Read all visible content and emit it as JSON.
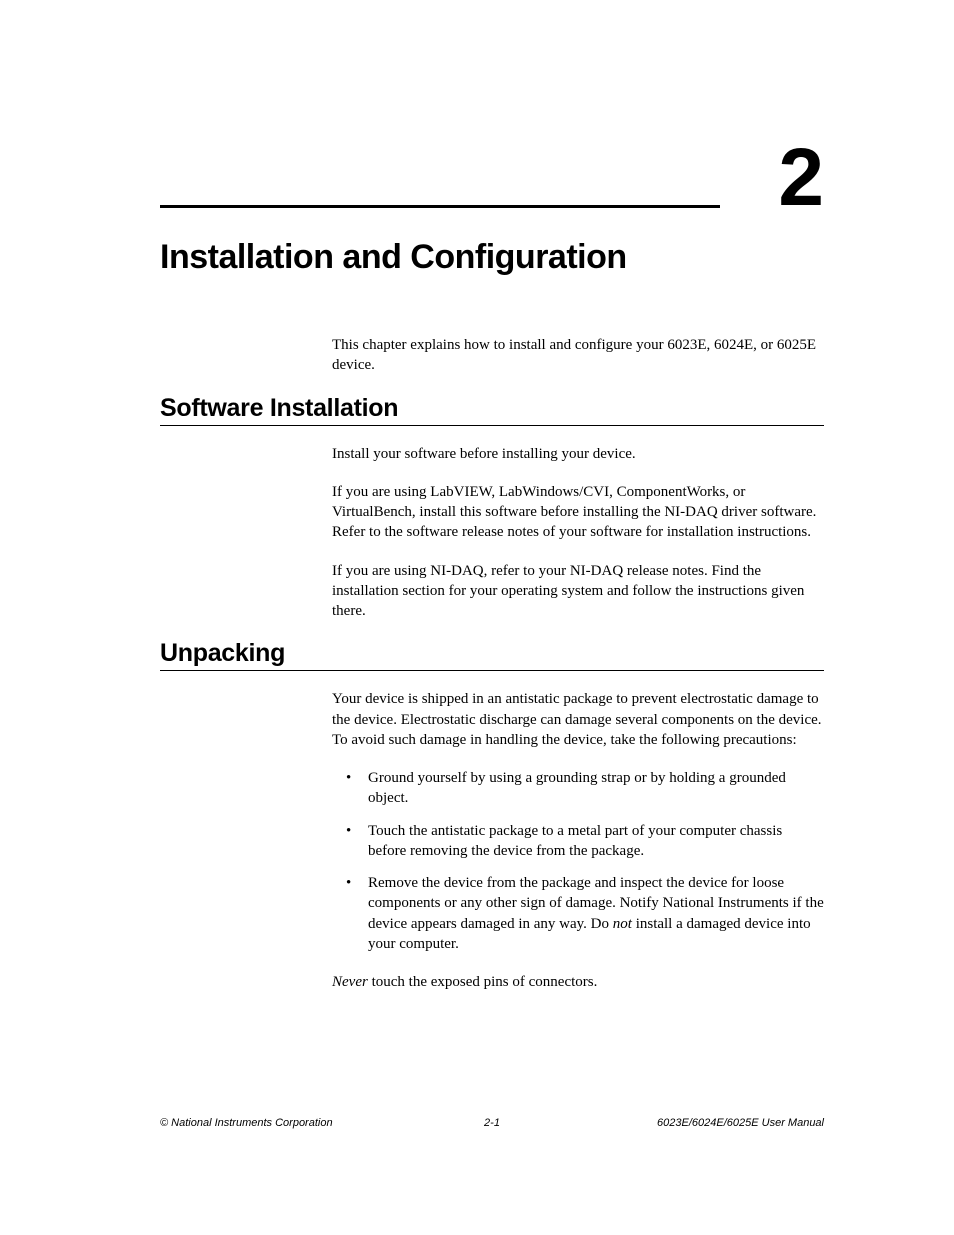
{
  "chapter": {
    "number": "2",
    "title": "Installation and Configuration",
    "intro": "This chapter explains how to install and configure your 6023E, 6024E, or 6025E device."
  },
  "sections": {
    "software": {
      "heading": "Software Installation",
      "p1": "Install your software before installing your device.",
      "p2": "If you are using LabVIEW, LabWindows/CVI, ComponentWorks, or VirtualBench, install this software before installing the NI-DAQ driver software. Refer to the software release notes of your software for installation instructions.",
      "p3": "If you are using NI-DAQ, refer to your NI-DAQ release notes. Find the installation section for your operating system and follow the instructions given there."
    },
    "unpacking": {
      "heading": "Unpacking",
      "p1": "Your device is shipped in an antistatic package to prevent electrostatic damage to the device. Electrostatic discharge can damage several components on the device. To avoid such damage in handling the device, take the following precautions:",
      "bullets": {
        "b1": "Ground yourself by using a grounding strap or by holding a grounded object.",
        "b2": "Touch the antistatic package to a metal part of your computer chassis before removing the device from the package.",
        "b3_pre": "Remove the device from the package and inspect the device for loose components or any other sign of damage. Notify National Instruments if the device appears damaged in any way. Do ",
        "b3_em": "not",
        "b3_post": " install a damaged device into your computer."
      },
      "p2_em": "Never",
      "p2_post": " touch the exposed pins of connectors."
    }
  },
  "footer": {
    "left": "© National Instruments Corporation",
    "center": "2-1",
    "right": "6023E/6024E/6025E User Manual"
  }
}
